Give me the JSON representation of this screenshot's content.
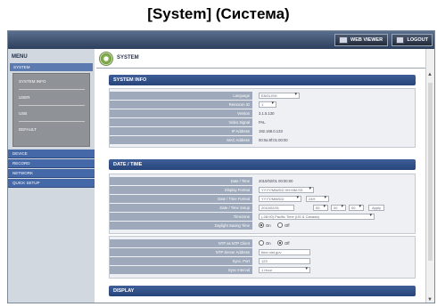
{
  "caption": "[System] (Система)",
  "topbar": {
    "web_viewer": "WEB VIEWER",
    "logout": "LOGOUT"
  },
  "sidebar": {
    "menu_title": "MENU",
    "system": "SYSTEM",
    "sub_items": [
      "SYSTEM INFO",
      "USER",
      "USB",
      "DEFAULT"
    ],
    "items": [
      "DEVICE",
      "RECORD",
      "NETWORK",
      "QUICK SETUP"
    ]
  },
  "page_title": "SYSTEM",
  "system_info": {
    "title": "SYSTEM INFO",
    "language_label": "Language",
    "language_value": "ENGLISH",
    "remocon_label": "Remocon ID",
    "remocon_value": "1",
    "version_label": "Version",
    "version_value": "3.1.5.130",
    "video_signal_label": "Video Signal",
    "video_signal_value": "PAL",
    "ip_label": "IP Address",
    "ip_value": "192.168.0.133",
    "mac_label": "MAC Address",
    "mac_value": "00:0a:8f:01:00:00"
  },
  "date_time": {
    "title": "DATE / TIME",
    "date_time_label": "Date / Time",
    "date_time_value": "2010/02/01 00:00:00",
    "display_format_label": "Display Format",
    "display_format_value": "YYYY/MM/DD HH:MM:SS",
    "date_time_format_label": "Date / Time Format",
    "date_format_value": "YYYY/MM/DD",
    "time_format_value": "24H",
    "date_time_setup_label": "Date / Time Setup",
    "setup_date_value": "2010/02/01",
    "setup_hour": "00",
    "setup_min": "00",
    "setup_sec": "00",
    "apply_label": "Apply",
    "timezone_label": "Timezone",
    "timezone_value": "(-08:00) Pacific Time (US & Canada)",
    "dst_label": "Daylight Saving Time",
    "dst_on": "On",
    "dst_off": "Off",
    "ntp_client_label": "NTP as NTP Client",
    "ntp_on": "On",
    "ntp_off": "Off",
    "ntp_server_label": "NTP Server Address",
    "ntp_server_value": "time.nist.gov",
    "sync_port_label": "Sync. Port",
    "sync_port_value": "123",
    "sync_interval_label": "Sync Interval",
    "sync_interval_value": "1 Hour"
  },
  "display": {
    "title": "DISPLAY"
  }
}
